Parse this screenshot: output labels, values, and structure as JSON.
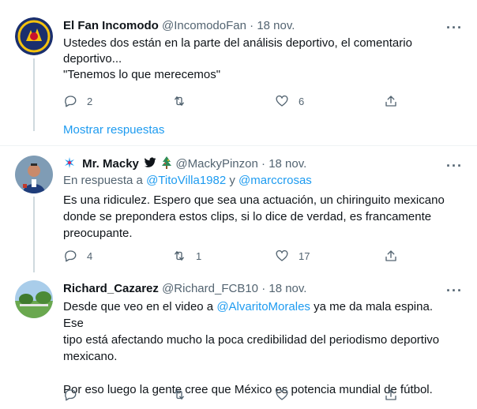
{
  "tweets": [
    {
      "name": "El Fan Incomodo",
      "handle": "@IncomodoFan",
      "dot": "·",
      "time": "18 nov.",
      "lines": [
        "Ustedes dos están en la parte del análisis deportivo, el comentario",
        "deportivo...",
        "\"Tenemos lo que merecemos\""
      ],
      "replies": "2",
      "retweets": "",
      "likes": "6",
      "show_replies": "Mostrar respuestas"
    },
    {
      "name": "Mr. Macky",
      "handle": "@MackyPinzon",
      "dot": "·",
      "time": "18 nov.",
      "reply_prefix": "En respuesta a ",
      "reply_user1": "@TitoVilla1982",
      "reply_and": " y ",
      "reply_user2": "@marccrosas",
      "lines": [
        "Es una ridiculez. Espero que sea una actuación, un chiringuito mexicano",
        "donde se prepondera estos clips, si lo dice de verdad, es francamente",
        "preocupante."
      ],
      "replies": "4",
      "retweets": "1",
      "likes": "17"
    },
    {
      "name": "Richard_Cazarez",
      "handle": "@Richard_FCB10",
      "dot": "·",
      "time": "18 nov.",
      "line1_before": "Desde que veo en el video a ",
      "line1_mention": "@AlvaritoMorales",
      "line1_after": " ya me da mala espina. Ese",
      "lines": [
        "tipo está afectando mucho la poca credibilidad del periodismo deportivo",
        "mexicano.",
        "Por eso luego la gente cree que México es potencia mundial de fútbol."
      ],
      "replies": "",
      "retweets": "",
      "likes": ""
    }
  ],
  "more_glyph": "···",
  "colors": {
    "accent": "#1d9bf0",
    "secondary": "#536471",
    "text": "#0f1419",
    "divider": "#eff3f4"
  },
  "icons": [
    "reply-icon",
    "retweet-icon",
    "like-icon",
    "share-icon",
    "more-icon",
    "twitter-bird-icon",
    "christmas-tree-icon",
    "sparkle-icon"
  ]
}
